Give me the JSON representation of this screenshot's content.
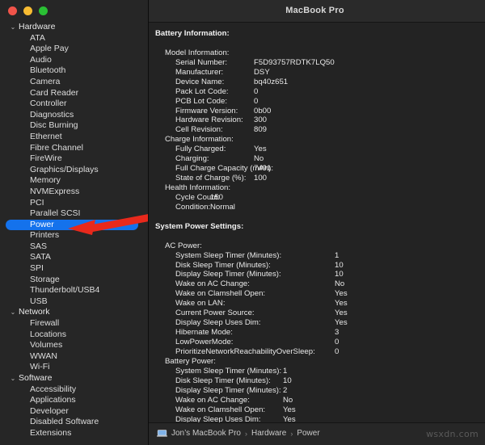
{
  "window": {
    "title": "MacBook Pro",
    "controls": [
      {
        "name": "close",
        "color": "#f1544a"
      },
      {
        "name": "minimize",
        "color": "#f8bc32"
      },
      {
        "name": "maximize",
        "color": "#2ac034"
      }
    ],
    "accent": "#1472ec",
    "annotation_color": "#e8291c"
  },
  "sidebar": {
    "items": [
      {
        "label": "Hardware",
        "type": "group",
        "caret": "⌄"
      },
      {
        "label": "ATA",
        "type": "child"
      },
      {
        "label": "Apple Pay",
        "type": "child"
      },
      {
        "label": "Audio",
        "type": "child"
      },
      {
        "label": "Bluetooth",
        "type": "child"
      },
      {
        "label": "Camera",
        "type": "child"
      },
      {
        "label": "Card Reader",
        "type": "child"
      },
      {
        "label": "Controller",
        "type": "child"
      },
      {
        "label": "Diagnostics",
        "type": "child"
      },
      {
        "label": "Disc Burning",
        "type": "child"
      },
      {
        "label": "Ethernet",
        "type": "child"
      },
      {
        "label": "Fibre Channel",
        "type": "child"
      },
      {
        "label": "FireWire",
        "type": "child"
      },
      {
        "label": "Graphics/Displays",
        "type": "child"
      },
      {
        "label": "Memory",
        "type": "child"
      },
      {
        "label": "NVMExpress",
        "type": "child"
      },
      {
        "label": "PCI",
        "type": "child"
      },
      {
        "label": "Parallel SCSI",
        "type": "child"
      },
      {
        "label": "Power",
        "type": "child",
        "selected": true
      },
      {
        "label": "Printers",
        "type": "child"
      },
      {
        "label": "SAS",
        "type": "child"
      },
      {
        "label": "SATA",
        "type": "child"
      },
      {
        "label": "SPI",
        "type": "child"
      },
      {
        "label": "Storage",
        "type": "child"
      },
      {
        "label": "Thunderbolt/USB4",
        "type": "child"
      },
      {
        "label": "USB",
        "type": "child"
      },
      {
        "label": "Network",
        "type": "group",
        "caret": "⌄"
      },
      {
        "label": "Firewall",
        "type": "child"
      },
      {
        "label": "Locations",
        "type": "child"
      },
      {
        "label": "Volumes",
        "type": "child"
      },
      {
        "label": "WWAN",
        "type": "child"
      },
      {
        "label": "Wi-Fi",
        "type": "child"
      },
      {
        "label": "Software",
        "type": "group",
        "caret": "⌄"
      },
      {
        "label": "Accessibility",
        "type": "child"
      },
      {
        "label": "Applications",
        "type": "child"
      },
      {
        "label": "Developer",
        "type": "child"
      },
      {
        "label": "Disabled Software",
        "type": "child"
      },
      {
        "label": "Extensions",
        "type": "child"
      }
    ]
  },
  "content": {
    "battery_heading": "Battery Information:",
    "model_heading": "Model Information:",
    "model_rows": [
      {
        "key": "Serial Number:",
        "value": "F5D93757RDTK7LQ50"
      },
      {
        "key": "Manufacturer:",
        "value": "DSY"
      },
      {
        "key": "Device Name:",
        "value": "bq40z651"
      },
      {
        "key": "Pack Lot Code:",
        "value": "0"
      },
      {
        "key": "PCB Lot Code:",
        "value": "0"
      },
      {
        "key": "Firmware Version:",
        "value": "0b00"
      },
      {
        "key": "Hardware Revision:",
        "value": "300"
      },
      {
        "key": "Cell Revision:",
        "value": "809"
      }
    ],
    "charge_heading": "Charge Information:",
    "charge_rows": [
      {
        "key": "Fully Charged:",
        "value": "Yes"
      },
      {
        "key": "Charging:",
        "value": "No"
      },
      {
        "key": "Full Charge Capacity (mAh):",
        "value": "7491"
      },
      {
        "key": "State of Charge (%):",
        "value": "100"
      }
    ],
    "health_heading": "Health Information:",
    "health_rows": [
      {
        "key": "Cycle Count:",
        "value": "150"
      },
      {
        "key": "Condition:",
        "value": "Normal"
      }
    ],
    "power_settings_heading": "System Power Settings:",
    "ac_power_heading": "AC Power:",
    "ac_power_rows": [
      {
        "key": "System Sleep Timer (Minutes):",
        "value": "1"
      },
      {
        "key": "Disk Sleep Timer (Minutes):",
        "value": "10"
      },
      {
        "key": "Display Sleep Timer (Minutes):",
        "value": "10"
      },
      {
        "key": "Wake on AC Change:",
        "value": "No"
      },
      {
        "key": "Wake on Clamshell Open:",
        "value": "Yes"
      },
      {
        "key": "Wake on LAN:",
        "value": "Yes"
      },
      {
        "key": "Current Power Source:",
        "value": "Yes"
      },
      {
        "key": "Display Sleep Uses Dim:",
        "value": "Yes"
      },
      {
        "key": "Hibernate Mode:",
        "value": "3"
      },
      {
        "key": "LowPowerMode:",
        "value": "0"
      },
      {
        "key": "PrioritizeNetworkReachabilityOverSleep:",
        "value": "0"
      }
    ],
    "battery_power_heading": "Battery Power:",
    "battery_power_rows": [
      {
        "key": "System Sleep Timer (Minutes):",
        "value": "1"
      },
      {
        "key": "Disk Sleep Timer (Minutes):",
        "value": "10"
      },
      {
        "key": "Display Sleep Timer (Minutes):",
        "value": "2"
      },
      {
        "key": "Wake on AC Change:",
        "value": "No"
      },
      {
        "key": "Wake on Clamshell Open:",
        "value": "Yes"
      },
      {
        "key": "Display Sleep Uses Dim:",
        "value": "Yes"
      }
    ]
  },
  "statusbar": {
    "device": "Jon’s MacBook Pro",
    "sep": "›",
    "crumb2": "Hardware",
    "crumb3": "Power",
    "watermark": "wsxdn.com"
  }
}
